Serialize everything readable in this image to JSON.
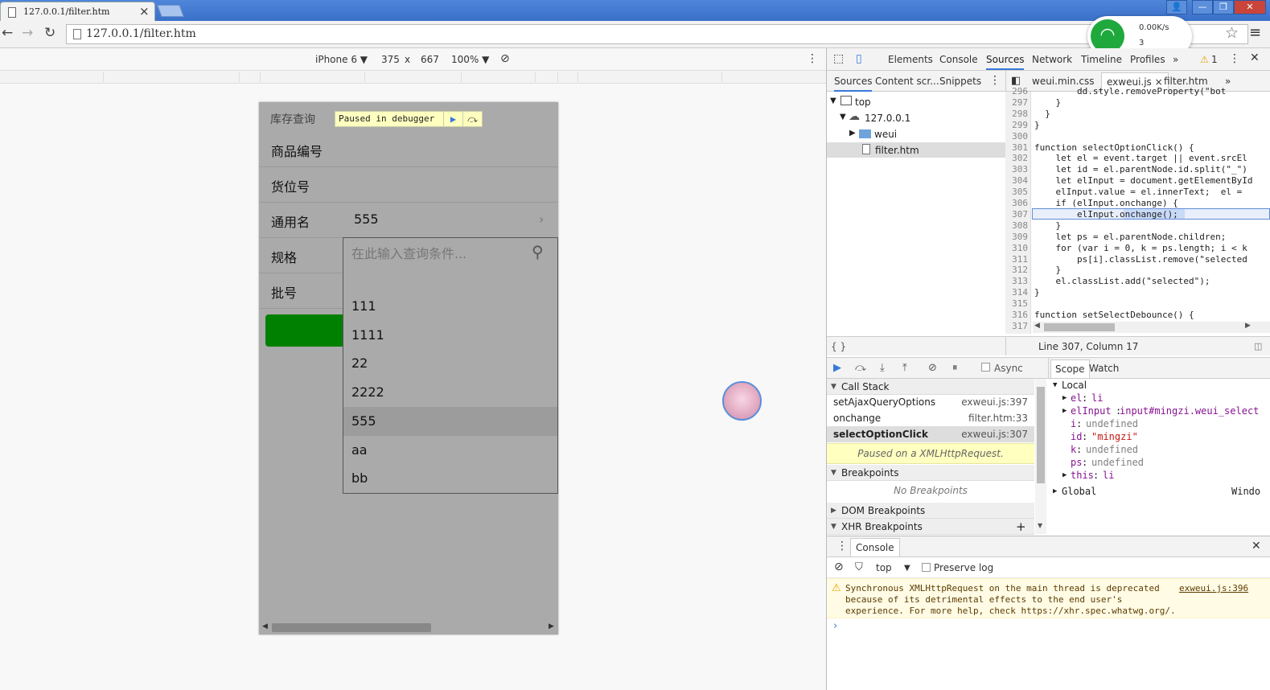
{
  "browser": {
    "tab_title": "127.0.0.1/filter.htm",
    "url": "127.0.0.1/filter.htm",
    "window_buttons": [
      "👤",
      "—",
      "❐",
      "✕"
    ]
  },
  "wifi": {
    "speed": "0.00K/s",
    "count": "3"
  },
  "device": {
    "name": "iPhone 6 ▼",
    "width": "375",
    "times": "x",
    "height": "667",
    "zoom": "100% ▼"
  },
  "page": {
    "title": "库存查询",
    "paused": "Paused in debugger",
    "fields": [
      {
        "label": "商品编号",
        "value": ""
      },
      {
        "label": "货位号",
        "value": ""
      },
      {
        "label": "通用名",
        "value": "555"
      },
      {
        "label": "规格",
        "value": ""
      },
      {
        "label": "批号",
        "value": ""
      }
    ],
    "chevron": "›",
    "search_placeholder": "在此输入查询条件...",
    "options": [
      "111",
      "1111",
      "22",
      "2222",
      "555",
      "aa",
      "bb"
    ],
    "selected_option": "555"
  },
  "devtools": {
    "tabs": [
      "Elements",
      "Console",
      "Sources",
      "Network",
      "Timeline",
      "Profiles"
    ],
    "more": "»",
    "warning_count": "1",
    "nav_tabs": [
      "Sources",
      "Content scr...",
      "Snippets"
    ],
    "tree": {
      "top": "top",
      "host": "127.0.0.1",
      "folder": "weui",
      "file": "filter.htm"
    },
    "editor_tabs": [
      "weui.min.css",
      "exweui.js",
      "filter.htm"
    ],
    "status": "Line 307, Column 17",
    "code_lines": [
      {
        "n": "296",
        "t": "        dd.style.removeProperty(\"bot"
      },
      {
        "n": "297",
        "t": "    }"
      },
      {
        "n": "298",
        "t": "  }"
      },
      {
        "n": "299",
        "t": "}"
      },
      {
        "n": "300",
        "t": ""
      },
      {
        "n": "301",
        "t": "function selectOptionClick() {"
      },
      {
        "n": "302",
        "t": "    let el = event.target || event.srcEl"
      },
      {
        "n": "303",
        "t": "    let id = el.parentNode.id.split(\"_\")"
      },
      {
        "n": "304",
        "t": "    let elInput = document.getElementById"
      },
      {
        "n": "305",
        "t": "    elInput.value = el.innerText;  el = "
      },
      {
        "n": "306",
        "t": "    if (elInput.onchange) {"
      },
      {
        "n": "307",
        "t": "        elInput.onchange();"
      },
      {
        "n": "308",
        "t": "    }"
      },
      {
        "n": "309",
        "t": "    let ps = el.parentNode.children;"
      },
      {
        "n": "310",
        "t": "    for (var i = 0, k = ps.length; i < k"
      },
      {
        "n": "311",
        "t": "        ps[i].classList.remove(\"selected"
      },
      {
        "n": "312",
        "t": "    }"
      },
      {
        "n": "313",
        "t": "    el.classList.add(\"selected\");"
      },
      {
        "n": "314",
        "t": "}"
      },
      {
        "n": "315",
        "t": ""
      },
      {
        "n": "316",
        "t": "function setSelectDebounce() {"
      },
      {
        "n": "317",
        "t": ""
      }
    ],
    "async": "Async",
    "scope_tabs": [
      "Scope",
      "Watch"
    ],
    "sections": {
      "call_stack": "Call Stack",
      "breakpoints": "Breakpoints",
      "dom_bp": "DOM Breakpoints",
      "xhr_bp": "XHR Breakpoints"
    },
    "call_stack": [
      {
        "fn": "setAjaxQueryOptions",
        "loc": "exweui.js:397"
      },
      {
        "fn": "onchange",
        "loc": "filter.htm:33"
      },
      {
        "fn": "selectOptionClick",
        "loc": "exweui.js:307"
      }
    ],
    "paused_msg": "Paused on a XMLHttpRequest.",
    "no_bp": "No Breakpoints",
    "scope": {
      "local": "Local",
      "el_k": "el",
      "el_v": "li",
      "elinput_k": "elInput",
      "elinput_v": "input#mingzi.weui_select",
      "i_k": "i",
      "i_v": "undefined",
      "id_k": "id",
      "id_v": "\"mingzi\"",
      "k_k": "k",
      "k_v": "undefined",
      "ps_k": "ps",
      "ps_v": "undefined",
      "this_k": "this",
      "this_v": "li",
      "global": "Global",
      "global_v": "Windo"
    },
    "console": {
      "tab": "Console",
      "context": "top",
      "preserve": "Preserve log",
      "warning": "Synchronous XMLHttpRequest on the main thread is deprecated because of its detrimental effects to the end user's experience. For more help, check https://xhr.spec.whatwg.org/.",
      "warning_src": "exweui.js:396",
      "prompt": "›"
    }
  }
}
